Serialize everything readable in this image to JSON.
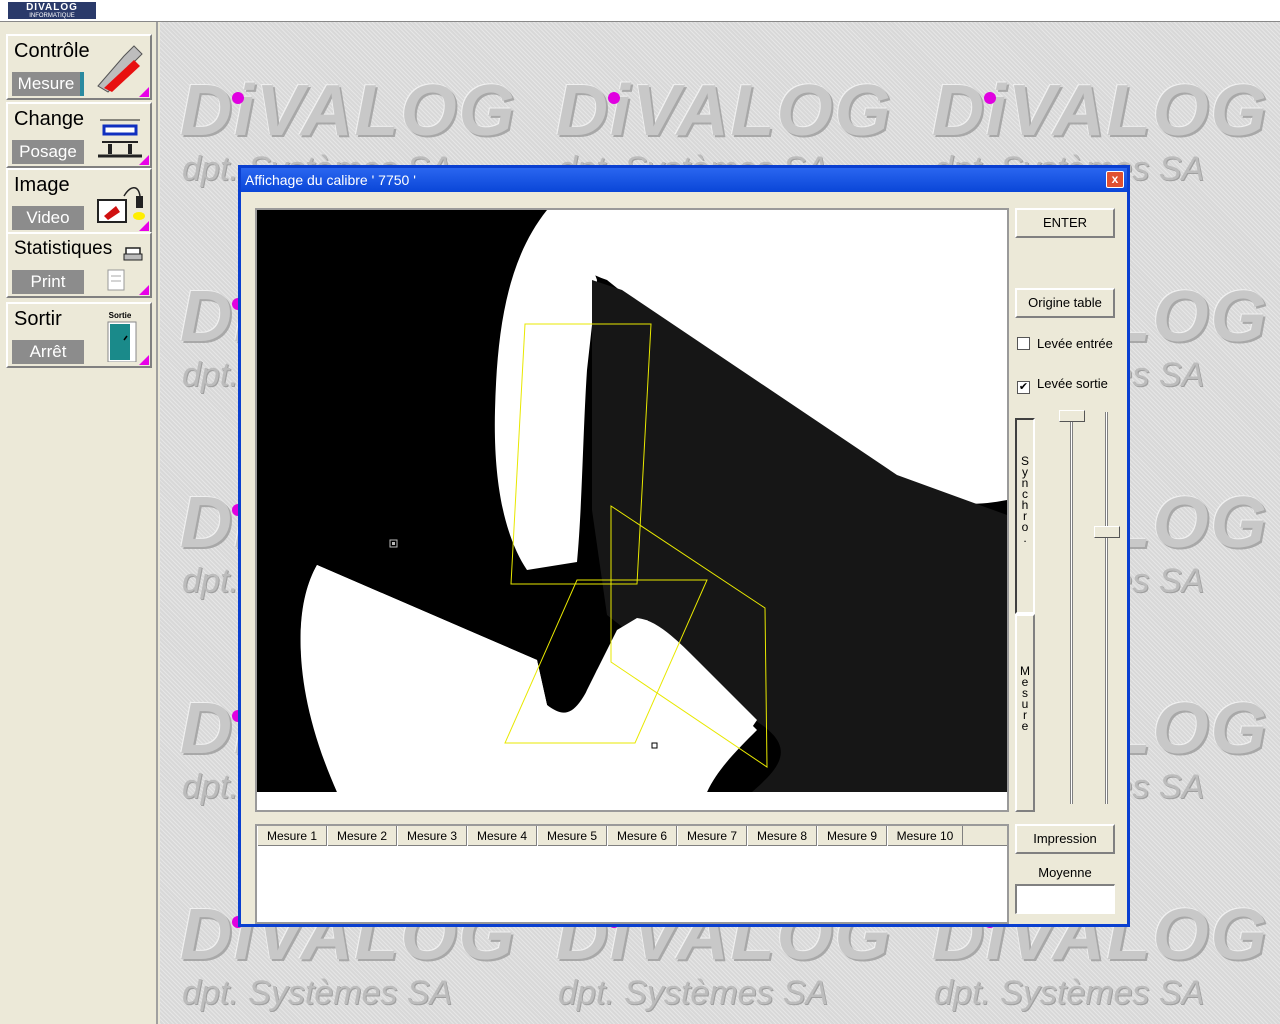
{
  "header": {
    "logo_text": "DIVALOG",
    "logo_sub": "INFORMATIQUE"
  },
  "sidebar": {
    "items": [
      {
        "title": "Contrôle",
        "sub": "Mesure",
        "icon": "caliper-measure-icon"
      },
      {
        "title": "Change",
        "sub": "Posage",
        "icon": "fixture-change-icon"
      },
      {
        "title": "Image",
        "sub": "Video",
        "icon": "video-camera-icon"
      },
      {
        "title": "Statistiques",
        "sub": "Print",
        "icon": "printer-icon"
      },
      {
        "title": "Sortir",
        "sub": "Arrêt",
        "icon": "exit-door-icon",
        "icon_label": "Sortie"
      }
    ]
  },
  "watermark": {
    "brand": "DiVALOG",
    "tagline": "dpt. Systèmes SA"
  },
  "dialog": {
    "title": "Affichage du calibre ' 7750 '",
    "close_label": "x",
    "buttons": {
      "enter": "ENTER",
      "origine": "Origine table",
      "impression": "Impression"
    },
    "checkboxes": [
      {
        "label": "Levée entrée",
        "checked": false
      },
      {
        "label": "Levée sortie",
        "checked": true
      }
    ],
    "synchro_label": "S\ny\nn\nc\nh\nr\no\n.",
    "mesure_label": "M\ne\ns\nu\nr\ne",
    "slider_left_level": 0.0,
    "slider_right_level": 0.31,
    "moyenne_label": "Moyenne",
    "moyenne_value": "",
    "tabs": [
      "Mesure 1",
      "Mesure 2",
      "Mesure 3",
      "Mesure 4",
      "Mesure 5",
      "Mesure 6",
      "Mesure 7",
      "Mesure 8",
      "Mesure 9",
      "Mesure 10"
    ]
  },
  "colors": {
    "accent_magenta": "#e800e8",
    "titlebar_blue": "#0a46d8",
    "overlay_yellow": "#ffff00"
  }
}
